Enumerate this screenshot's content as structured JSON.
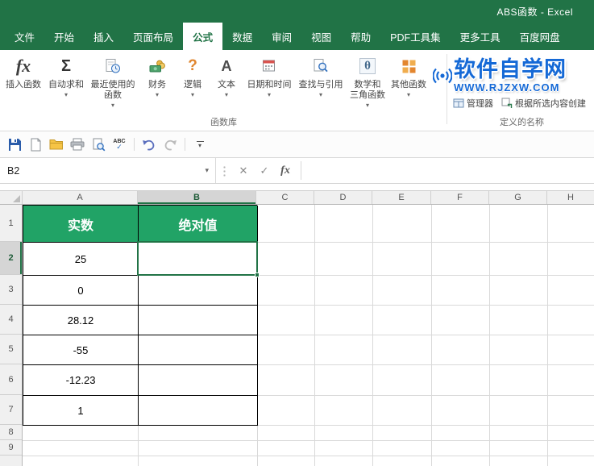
{
  "colors": {
    "excel_green": "#217346",
    "cell_header_fill": "#21a366",
    "selection_border": "#217346",
    "watermark_blue": "#1569d6"
  },
  "title_bar": {
    "title": "ABS函数  -  Excel"
  },
  "tabs": [
    {
      "label": "文件"
    },
    {
      "label": "开始"
    },
    {
      "label": "插入"
    },
    {
      "label": "页面布局"
    },
    {
      "label": "公式"
    },
    {
      "label": "数据"
    },
    {
      "label": "审阅"
    },
    {
      "label": "视图"
    },
    {
      "label": "帮助"
    },
    {
      "label": "PDF工具集"
    },
    {
      "label": "更多工具"
    },
    {
      "label": "百度网盘"
    }
  ],
  "active_tab": "公式",
  "ribbon": {
    "buttons": [
      {
        "label": "插入函数"
      },
      {
        "label": "自动求和"
      },
      {
        "label": "最近使用的\n函数"
      },
      {
        "label": "财务"
      },
      {
        "label": "逻辑"
      },
      {
        "label": "文本"
      },
      {
        "label": "日期和时间"
      },
      {
        "label": "查找与引用"
      },
      {
        "label": "数学和\n三角函数"
      },
      {
        "label": "其他函数"
      }
    ],
    "group_labels": {
      "function_library": "函数库",
      "defined_names": "定义的名称"
    },
    "defined_names": {
      "manager": "管理器",
      "create_from_selection": "根据所选内容创建"
    }
  },
  "watermark": {
    "title": "软件自学网",
    "url": "WWW.RJZXW.COM"
  },
  "formula_bar": {
    "name_box": "B2",
    "formula": ""
  },
  "icons": {
    "dropdown": "▾",
    "cancel": "✕",
    "enter": "✓",
    "fx": "fx",
    "sigma": "Σ",
    "question": "?",
    "letter_a": "A",
    "theta": "θ",
    "spell": "ABC"
  },
  "sheet": {
    "columns": [
      "A",
      "B",
      "C",
      "D",
      "E",
      "F",
      "G",
      "H"
    ],
    "rows": [
      "1",
      "2",
      "3",
      "4",
      "5",
      "6",
      "7",
      "8",
      "9"
    ],
    "selected_cell": "B2",
    "table": {
      "header_real": "实数",
      "header_abs": "绝对值",
      "values": [
        "25",
        "0",
        "28.12",
        "-55",
        "-12.23",
        "1"
      ]
    }
  }
}
